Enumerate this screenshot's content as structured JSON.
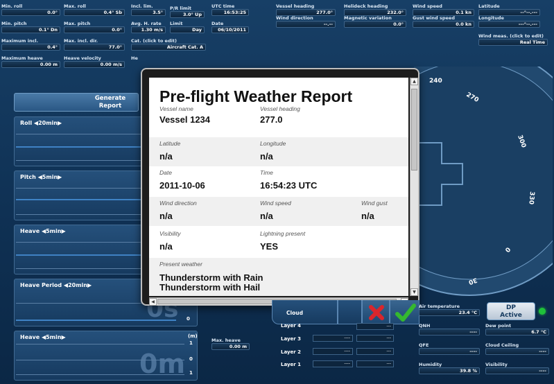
{
  "top_fields": [
    {
      "label": "Min. roll",
      "value": "0.0°"
    },
    {
      "label": "Max. roll",
      "value": "0.4° Sb"
    },
    {
      "label": "Incl. lim.",
      "value": "3.5°"
    },
    {
      "label": "P/R limit",
      "value": "3.0° Up"
    },
    {
      "label": "UTC time",
      "value": "16:53:25"
    },
    {
      "label": "Min. pitch",
      "value": "0.1° Dn"
    },
    {
      "label": "Max. pitch",
      "value": "0.0°"
    },
    {
      "label": "Avg. H. rate",
      "value": "1.30 m/s"
    },
    {
      "label": "Limit",
      "value": "Day"
    },
    {
      "label": "Date",
      "value": "06/10/2011"
    },
    {
      "label": "Maximum incl.",
      "value": "0.4°"
    },
    {
      "label": "Max. incl. dir.",
      "value": "77.0°"
    },
    {
      "label": "Cat. (click to edit)",
      "value": "Aircraft Cat. A"
    },
    {
      "label": "Maximum heave",
      "value": "0.00 m"
    },
    {
      "label": "Heave velocity",
      "value": "0.00 m/s"
    },
    {
      "label": "He",
      "value": ""
    },
    {
      "label": "Vessel heading",
      "value": "277.0°"
    },
    {
      "label": "Helideck heading",
      "value": "232.0°"
    },
    {
      "label": "Wind speed",
      "value": "0.1 kn"
    },
    {
      "label": "Latitude",
      "value": "--°--.---"
    },
    {
      "label": "Wind direction",
      "value": "--.--"
    },
    {
      "label": "Magnetic variation",
      "value": "0.0°"
    },
    {
      "label": "Gust wind speed",
      "value": "0.0 kn"
    },
    {
      "label": "Longitude",
      "value": "---°--.---"
    },
    {
      "label": "Wind meas. (click to edit)",
      "value": "Real Time"
    }
  ],
  "generate_report": "Generate Report",
  "panels": {
    "roll": "Roll ◀20min▶",
    "pitch": "Pitch ◀5min▶",
    "heave": "Heave ◀5min▶",
    "heave_period": "Heave Period ◀20min▶",
    "heave2": "Heave ◀5min▶"
  },
  "big_overlay": {
    "period": "0s",
    "heave": "0m"
  },
  "tick_labels": {
    "zero1": "0",
    "m": "(m)",
    "one": "1",
    "zero2": "0",
    "one2": "1"
  },
  "max_heave": {
    "label": "Max. heave",
    "value": "0.00 m"
  },
  "compass": {
    "labels": [
      "240",
      "270",
      "300",
      "330",
      "0",
      "30"
    ]
  },
  "report": {
    "title": "Pre-flight Weather Report",
    "vessel_name_k": "Vessel name",
    "vessel_name_v": "Vessel 1234",
    "vessel_heading_k": "Vessel heading",
    "vessel_heading_v": "277.0",
    "latitude_k": "Latitude",
    "latitude_v": "n/a",
    "longitude_k": "Longitude",
    "longitude_v": "n/a",
    "date_k": "Date",
    "date_v": "2011-10-06",
    "time_k": "Time",
    "time_v": "16:54:23 UTC",
    "wind_dir_k": "Wind direction",
    "wind_dir_v": "n/a",
    "wind_speed_k": "Wind speed",
    "wind_speed_v": "n/a",
    "wind_gust_k": "Wind gust",
    "wind_gust_v": "n/a",
    "visibility_k": "Visibility",
    "visibility_v": "n/a",
    "lightning_k": "Lightning present",
    "lightning_v": "YES",
    "present_weather_k": "Present weather",
    "present_weather_v1": "Thunderstorm with Rain",
    "present_weather_v2": "Thunderstorm with Hail"
  },
  "cloud": {
    "label": "Cloud",
    "layers": [
      "Layer 4",
      "Layer 3",
      "Layer 2",
      "Layer 1"
    ],
    "empty": "----",
    "empty2": "---"
  },
  "right_bottom": {
    "air_temp_label": "Air temperature",
    "air_temp": "23.4 °C",
    "qnh_label": "QNH",
    "qnh": "----",
    "qfe_label": "QFE",
    "qfe": "----",
    "humidity_label": "Humidity",
    "humidity": "39.8 %",
    "dew_label": "Dew point",
    "dew": "6.7 °C",
    "ceiling_label": "Cloud Ceiling",
    "ceiling": "----",
    "visibility_label": "Visibility",
    "visibility": "----",
    "dp_line1": "DP",
    "dp_line2": "Active"
  },
  "colors": {
    "accent": "#3f82c4",
    "cancel": "#d9262c",
    "ok": "#35b82f",
    "dp_led": "#1fc13a"
  }
}
